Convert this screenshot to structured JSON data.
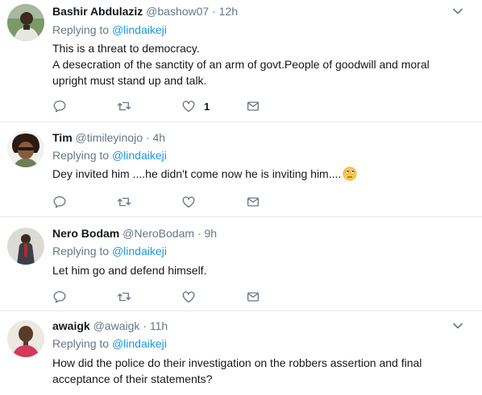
{
  "tweets": [
    {
      "name": "Bashir Abdulaziz",
      "handle": "@bashow07",
      "time": "· 12h",
      "replying_prefix": "Replying to ",
      "replying_to": "@lindaikeji",
      "text": "This is a threat to democracy.\nA desecration of the sanctity of an arm of govt.People of goodwill and moral upright must stand up and talk.",
      "like_count": "1"
    },
    {
      "name": "Tim",
      "handle": "@timileyinojo",
      "time": "· 4h",
      "replying_prefix": "Replying to ",
      "replying_to": "@lindaikeji",
      "text": "Dey invited him ....he didn't come now he is inviting him....",
      "emoji": "face-with-rolling-eyes"
    },
    {
      "name": "Nero Bodam",
      "handle": "@NeroBodam",
      "time": "· 9h",
      "replying_prefix": "Replying to ",
      "replying_to": "@lindaikeji",
      "text": "Let him go and defend himself."
    },
    {
      "name": "awaigk",
      "handle": "@awaigk",
      "time": "· 11h",
      "replying_prefix": "Replying to ",
      "replying_to": "@lindaikeji",
      "text": "How did the police do their investigation on the robbers assertion and final acceptance of their statements?"
    }
  ],
  "colors": {
    "link": "#1b95e0",
    "muted": "#657786",
    "divider": "#e6ecf0",
    "text": "#14171a"
  },
  "icons": [
    "reply-icon",
    "retweet-icon",
    "like-icon",
    "direct-message-icon",
    "chevron-down-icon"
  ]
}
